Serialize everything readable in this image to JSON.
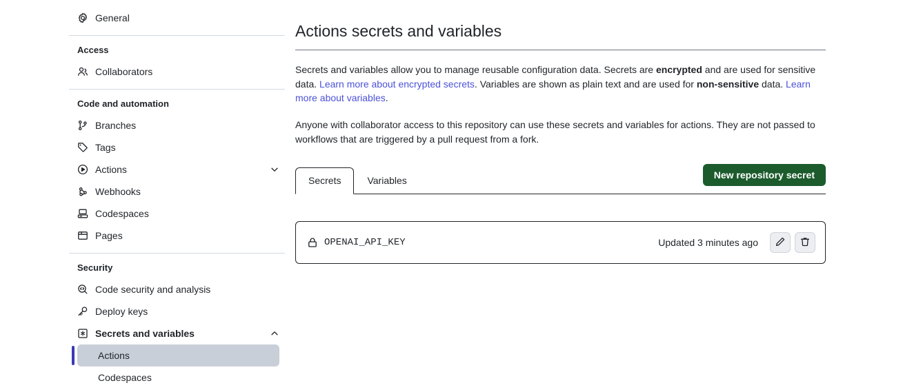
{
  "sidebar": {
    "top_items": [
      {
        "label": "General",
        "icon": "gear-icon"
      }
    ],
    "sections": [
      {
        "title": "Access",
        "items": [
          {
            "label": "Collaborators",
            "icon": "people-icon"
          }
        ]
      },
      {
        "title": "Code and automation",
        "items": [
          {
            "label": "Branches",
            "icon": "branch-icon"
          },
          {
            "label": "Tags",
            "icon": "tag-icon"
          },
          {
            "label": "Actions",
            "icon": "play-circle-icon",
            "chevron": "chevron-down-icon"
          },
          {
            "label": "Webhooks",
            "icon": "webhook-icon"
          },
          {
            "label": "Codespaces",
            "icon": "codespaces-icon"
          },
          {
            "label": "Pages",
            "icon": "browser-icon"
          }
        ]
      },
      {
        "title": "Security",
        "items": [
          {
            "label": "Code security and analysis",
            "icon": "code-scan-icon"
          },
          {
            "label": "Deploy keys",
            "icon": "key-icon"
          },
          {
            "label": "Secrets and variables",
            "icon": "asterisk-box-icon",
            "chevron": "chevron-up-icon",
            "bold": true
          }
        ],
        "sub_items": [
          {
            "label": "Actions",
            "active": true
          },
          {
            "label": "Codespaces",
            "active": false
          }
        ]
      }
    ]
  },
  "main": {
    "title": "Actions secrets and variables",
    "paragraph1": {
      "part1": "Secrets and variables allow you to manage reusable configuration data. Secrets are ",
      "bold1": "encrypted",
      "part2": " and are used for sensitive data. ",
      "link1": "Learn more about encrypted secrets",
      "part3": ". Variables are shown as plain text and are used for ",
      "bold2": "non-sensitive",
      "part4": " data. ",
      "link2": "Learn more about variables",
      "part5": "."
    },
    "paragraph2": "Anyone with collaborator access to this repository can use these secrets and variables for actions. They are not passed to workflows that are triggered by a pull request from a fork.",
    "tabs": [
      {
        "label": "Secrets",
        "active": true
      },
      {
        "label": "Variables",
        "active": false
      }
    ],
    "new_secret_button": "New repository secret",
    "secrets": [
      {
        "name": "OPENAI_API_KEY",
        "updated": "Updated 3 minutes ago",
        "lock_icon": "lock-icon",
        "edit_icon": "pencil-icon",
        "delete_icon": "trash-icon"
      }
    ]
  },
  "colors": {
    "button_green": "#1c5b2c",
    "link_blue": "#4b52d8",
    "active_indicator": "#3a3ab5",
    "active_bg": "#c9cfd8"
  }
}
